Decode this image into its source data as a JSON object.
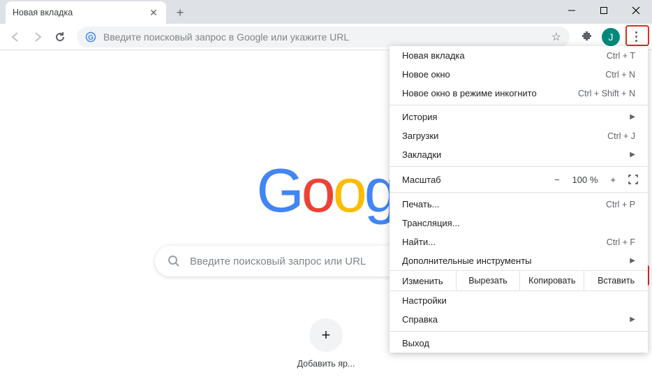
{
  "tab": {
    "title": "Новая вкладка"
  },
  "omnibox": {
    "placeholder": "Введите поисковый запрос в Google или укажите URL"
  },
  "avatar": {
    "initial": "J"
  },
  "search": {
    "placeholder": "Введите поисковый запрос или URL"
  },
  "add_shortcut": {
    "label": "Добавить яр..."
  },
  "menu": {
    "new_tab": {
      "label": "Новая вкладка",
      "shortcut": "Ctrl + T"
    },
    "new_window": {
      "label": "Новое окно",
      "shortcut": "Ctrl + N"
    },
    "incognito": {
      "label": "Новое окно в режиме инкогнито",
      "shortcut": "Ctrl + Shift + N"
    },
    "history": {
      "label": "История"
    },
    "downloads": {
      "label": "Загрузки",
      "shortcut": "Ctrl + J"
    },
    "bookmarks": {
      "label": "Закладки"
    },
    "zoom": {
      "label": "Масштаб",
      "value": "100 %"
    },
    "print": {
      "label": "Печать...",
      "shortcut": "Ctrl + P"
    },
    "cast": {
      "label": "Трансляция..."
    },
    "find": {
      "label": "Найти...",
      "shortcut": "Ctrl + F"
    },
    "more_tools": {
      "label": "Дополнительные инструменты"
    },
    "edit": {
      "label": "Изменить",
      "cut": "Вырезать",
      "copy": "Копировать",
      "paste": "Вставить"
    },
    "settings": {
      "label": "Настройки"
    },
    "help": {
      "label": "Справка"
    },
    "exit": {
      "label": "Выход"
    }
  }
}
